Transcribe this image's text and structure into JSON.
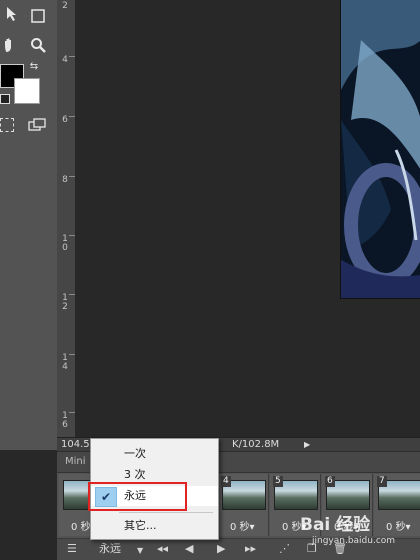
{
  "ruler": {
    "labels": [
      "4",
      "6",
      "8",
      "1\n0",
      "1\n2",
      "1\n4",
      "1\n6"
    ]
  },
  "status": {
    "zoom": "104.5",
    "doc": "K/102.8M"
  },
  "timeline": {
    "title": "Mini",
    "frames": [
      {
        "num": "4",
        "delay": "0 秒▾"
      },
      {
        "num": "5",
        "delay": "0 秒▾"
      },
      {
        "num": "6",
        "delay": "0 秒▾"
      },
      {
        "num": "7",
        "delay": "0 秒▾"
      }
    ],
    "first_frame_delay": "0 秒",
    "loop_value": "永远"
  },
  "menu": {
    "items": [
      "一次",
      "3 次",
      "永远",
      "其它..."
    ],
    "selected": "永远",
    "check": "✔"
  },
  "watermark": {
    "text": "Bai 经验",
    "url": "jingyan.baidu.com"
  },
  "colors": {
    "toolbar": "#535353",
    "canvas": "#282828",
    "highlight": "#e02424",
    "check_bg": "#9fcff0"
  }
}
